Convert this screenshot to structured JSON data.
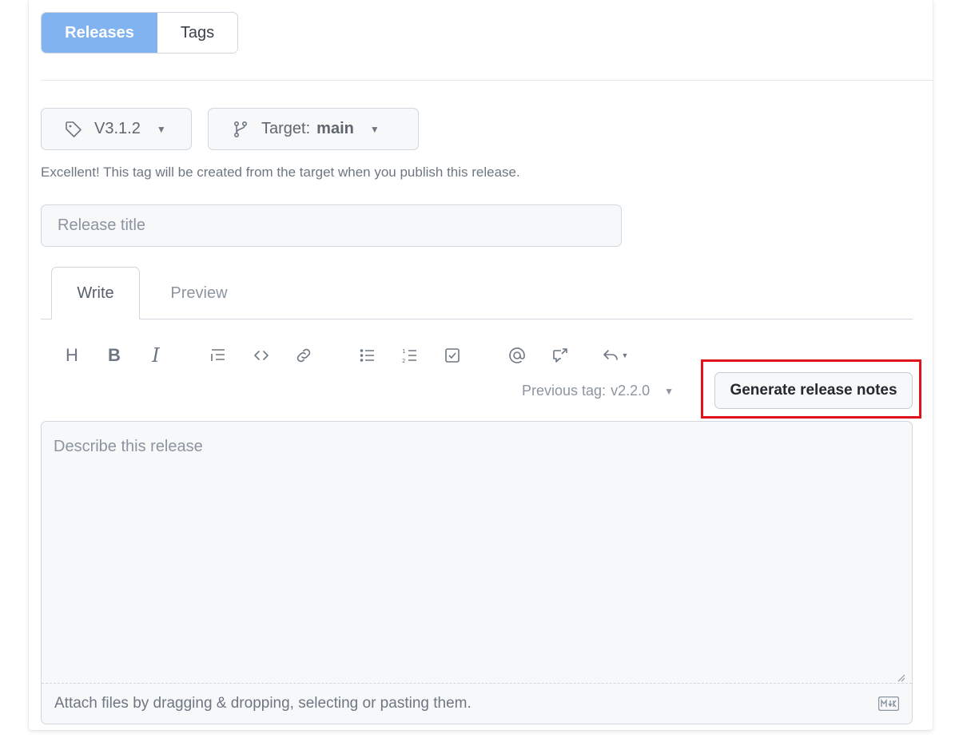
{
  "tabs": {
    "releases": "Releases",
    "tags": "Tags"
  },
  "tag_picker": {
    "value": "V3.1.2"
  },
  "target_picker": {
    "label": "Target:",
    "value": "main"
  },
  "hint": "Excellent! This tag will be created from the target when you publish this release.",
  "release_title": {
    "placeholder": "Release title",
    "value": ""
  },
  "editor_tabs": {
    "write": "Write",
    "preview": "Preview"
  },
  "toolbar": {
    "heading": "H",
    "bold": "B",
    "italic": "I",
    "icons": [
      "heading-icon",
      "bold-icon",
      "italic-icon",
      "quote-icon",
      "code-icon",
      "link-icon",
      "unordered-list-icon",
      "ordered-list-icon",
      "task-list-icon",
      "mention-icon",
      "reference-icon",
      "reply-icon"
    ]
  },
  "previous_tag": {
    "label": "Previous tag:",
    "value": "v2.2.0"
  },
  "generate_button": "Generate release notes",
  "editor": {
    "placeholder": "Describe this release",
    "attach_hint": "Attach files by dragging & dropping, selecting or pasting them."
  },
  "colors": {
    "accent": "#80b3ef",
    "highlight": "#e0121a",
    "border": "#d0d7de",
    "input_bg": "#f6f8fa"
  }
}
